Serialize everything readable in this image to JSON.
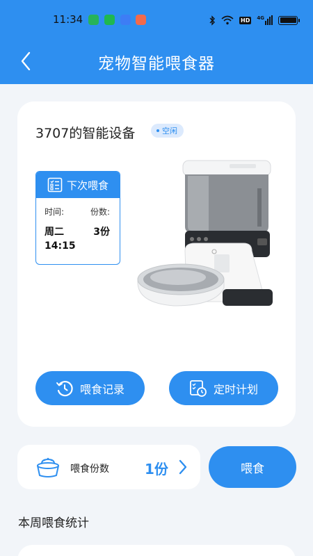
{
  "status_bar": {
    "time": "11:34",
    "hd_label": "HD",
    "net_label": "4G"
  },
  "header": {
    "title": "宠物智能喂食器"
  },
  "device": {
    "name": "3707的智能设备",
    "status": "空闲"
  },
  "next_feeding": {
    "title": "下次喂食",
    "time_label": "时间:",
    "portion_label": "份数:",
    "day": "周二",
    "time": "14:15",
    "portion": "3份"
  },
  "actions": {
    "history_label": "喂食记录",
    "schedule_label": "定时计划"
  },
  "portion": {
    "label": "喂食份数",
    "value": "1份"
  },
  "feed_button": "喂食",
  "weekly_stats": {
    "title": "本周喂食统计"
  },
  "colors": {
    "accent": "#2e8ff0",
    "background": "#f2f5f9",
    "badge_bg": "#dceafd"
  }
}
